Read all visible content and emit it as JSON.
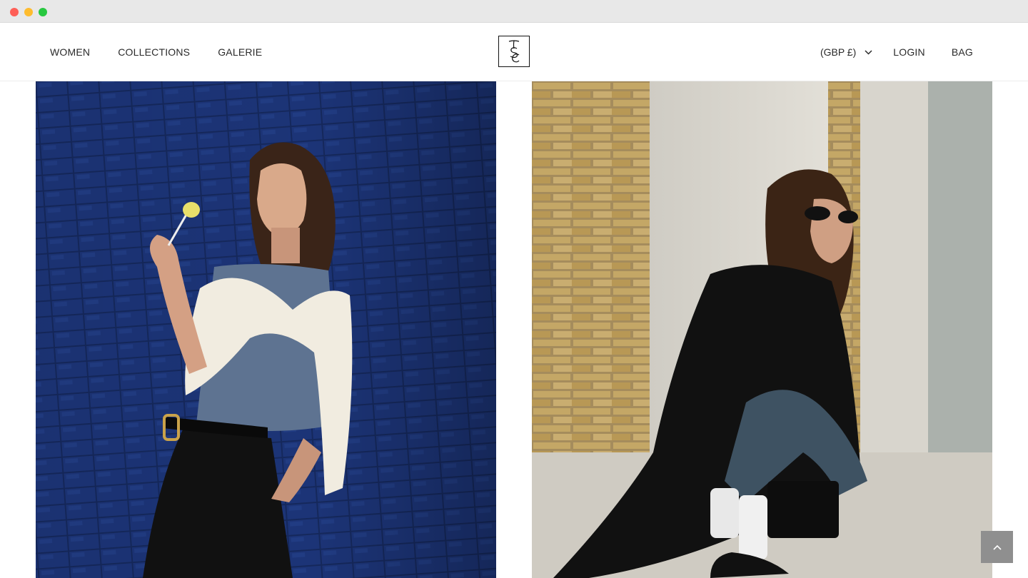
{
  "nav": {
    "left": [
      "WOMEN",
      "COLLECTIONS",
      "GALERIE"
    ],
    "currency": "(GBP £)",
    "login": "LOGIN",
    "bag": "BAG"
  },
  "logo": {
    "letters": "TSC",
    "icon": "monogram-logo"
  },
  "images": [
    {
      "name": "hero-photo-left",
      "description_icon": "model-blue-tile-wall-photo"
    },
    {
      "name": "hero-photo-right",
      "description_icon": "model-brick-wall-crouching-photo"
    }
  ],
  "icons": {
    "currency_caret": "chevron-down-icon",
    "scroll_top": "chevron-up-icon"
  },
  "colors": {
    "tile_blue": "#1a2f6b",
    "scroll_button": "#8f8f8f",
    "text": "#2a2a2a"
  }
}
